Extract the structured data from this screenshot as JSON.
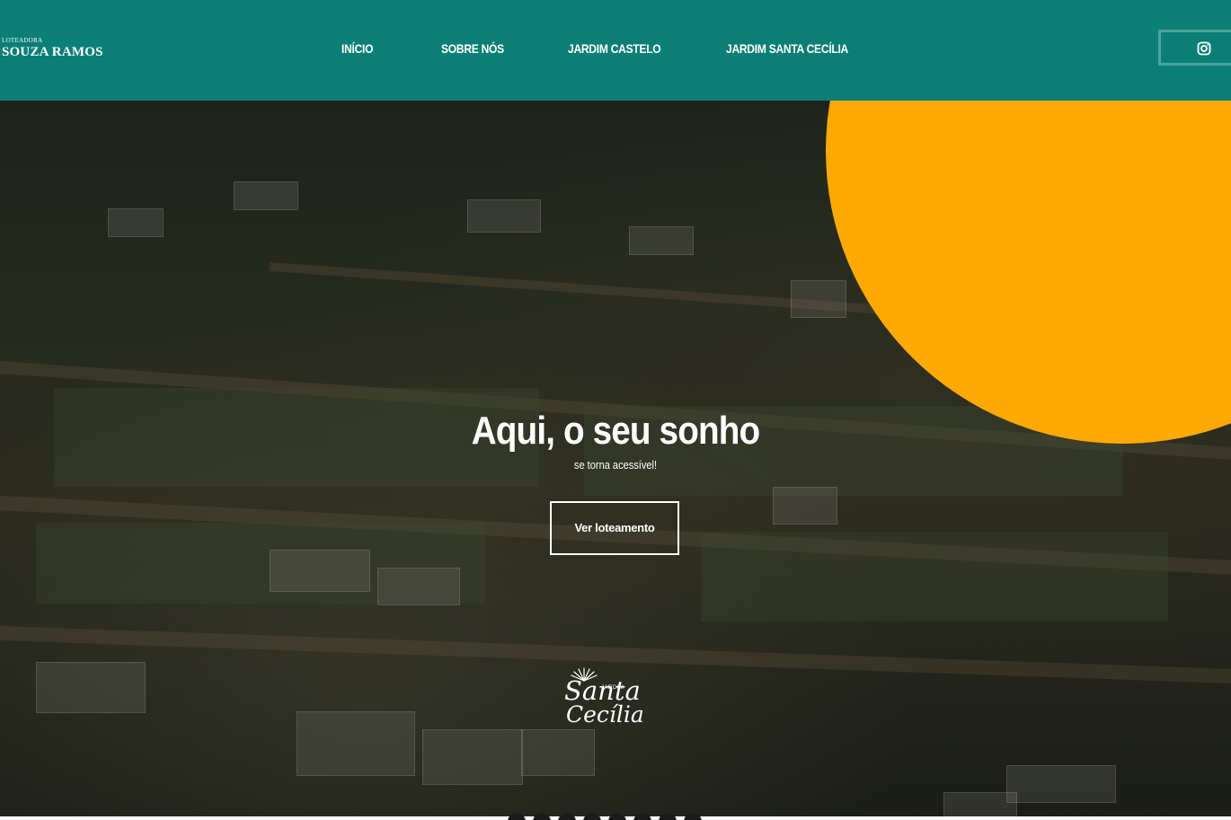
{
  "brand": {
    "small": "LOTEADORA",
    "name": "SOUZA RAMOS"
  },
  "nav": {
    "items": [
      {
        "label": "INÍCIO"
      },
      {
        "label": "SOBRE NÓS"
      },
      {
        "label": "JARDIM CASTELO"
      },
      {
        "label": "JARDIM SANTA CECÍLIA"
      }
    ],
    "instagram_icon": "instagram-icon"
  },
  "hero": {
    "title": "Aqui, o seu sonho",
    "subtitle": "se torna acessível!",
    "cta_label": "Ver loteamento",
    "logo_small": "JARDIM",
    "logo_line1": "Santa",
    "logo_line2": "Cecília"
  },
  "colors": {
    "header": "#0b7f76",
    "accent": "#ffa903",
    "text": "#ffffff"
  }
}
